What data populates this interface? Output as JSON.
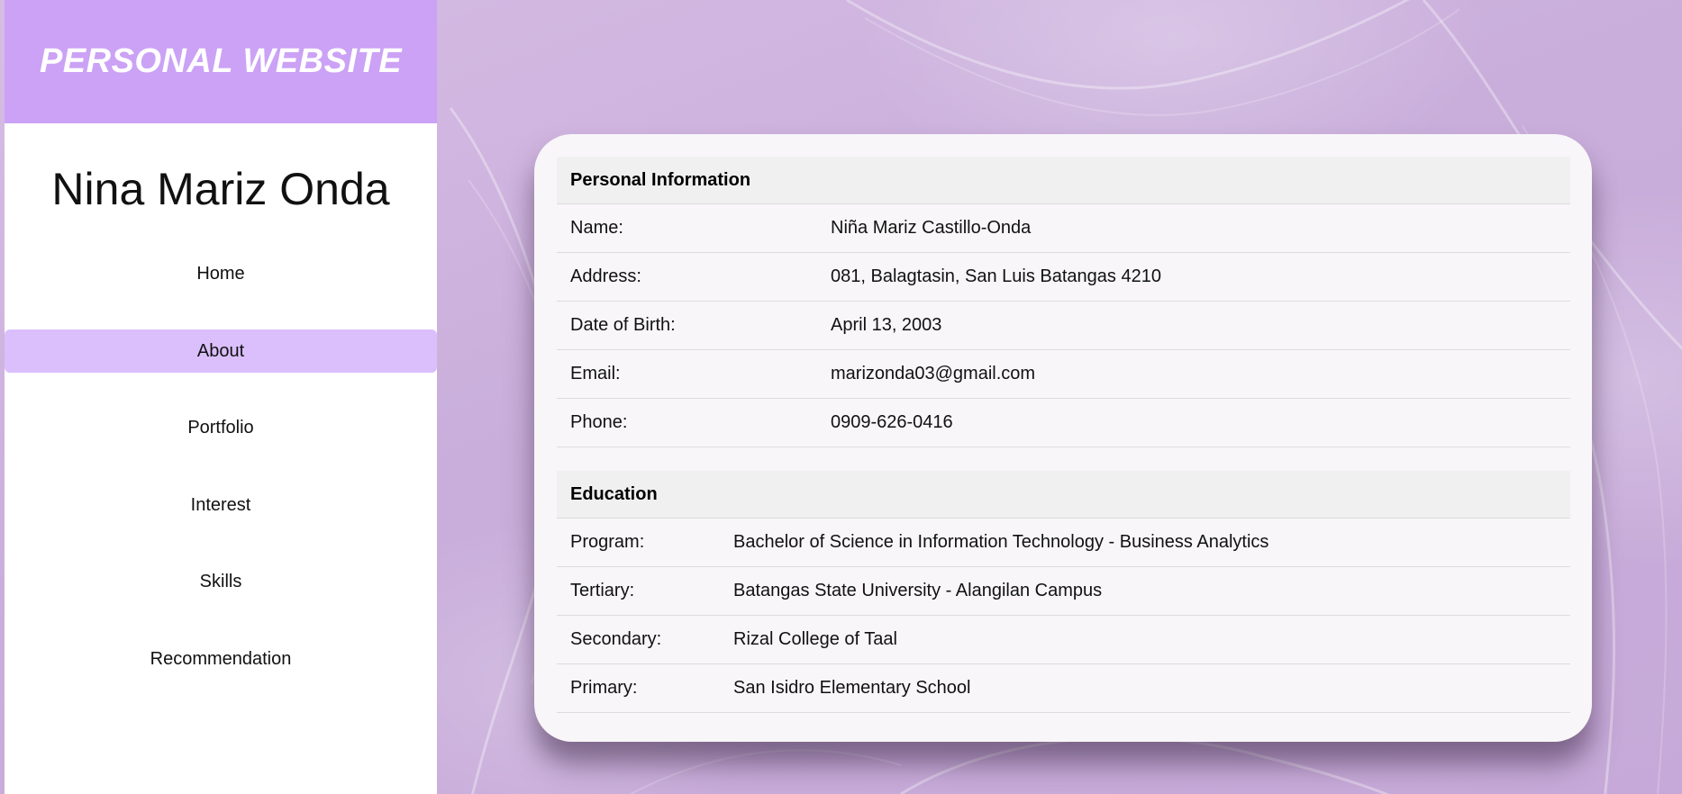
{
  "brand": {
    "title": "PERSONAL WEBSITE"
  },
  "owner": {
    "name": "Nina Mariz Onda"
  },
  "nav": {
    "items": [
      {
        "label": "Home",
        "active": false
      },
      {
        "label": "About",
        "active": true
      },
      {
        "label": "Portfolio",
        "active": false
      },
      {
        "label": "Interest",
        "active": false
      },
      {
        "label": "Skills",
        "active": false
      },
      {
        "label": "Recommendation",
        "active": false
      }
    ]
  },
  "personal": {
    "heading": "Personal Information",
    "rows": [
      {
        "label": "Name:",
        "value": "Niña Mariz Castillo-Onda"
      },
      {
        "label": "Address:",
        "value": "081, Balagtasin, San Luis Batangas 4210"
      },
      {
        "label": "Date of Birth:",
        "value": "April 13, 2003"
      },
      {
        "label": "Email:",
        "value": "marizonda03@gmail.com"
      },
      {
        "label": "Phone:",
        "value": "0909-626-0416"
      }
    ]
  },
  "education": {
    "heading": "Education",
    "rows": [
      {
        "label": "Program:",
        "value": "Bachelor of Science in Information Technology - Business Analytics"
      },
      {
        "label": "Tertiary:",
        "value": "Batangas State University - Alangilan Campus"
      },
      {
        "label": "Secondary:",
        "value": "Rizal College of Taal"
      },
      {
        "label": "Primary:",
        "value": "San Isidro Elementary School"
      }
    ]
  },
  "colors": {
    "brand_bg": "#cba2f5",
    "nav_active_bg": "#dbbffc",
    "page_bg": "#cdb3dd",
    "card_bg": "#f8f6f9"
  }
}
